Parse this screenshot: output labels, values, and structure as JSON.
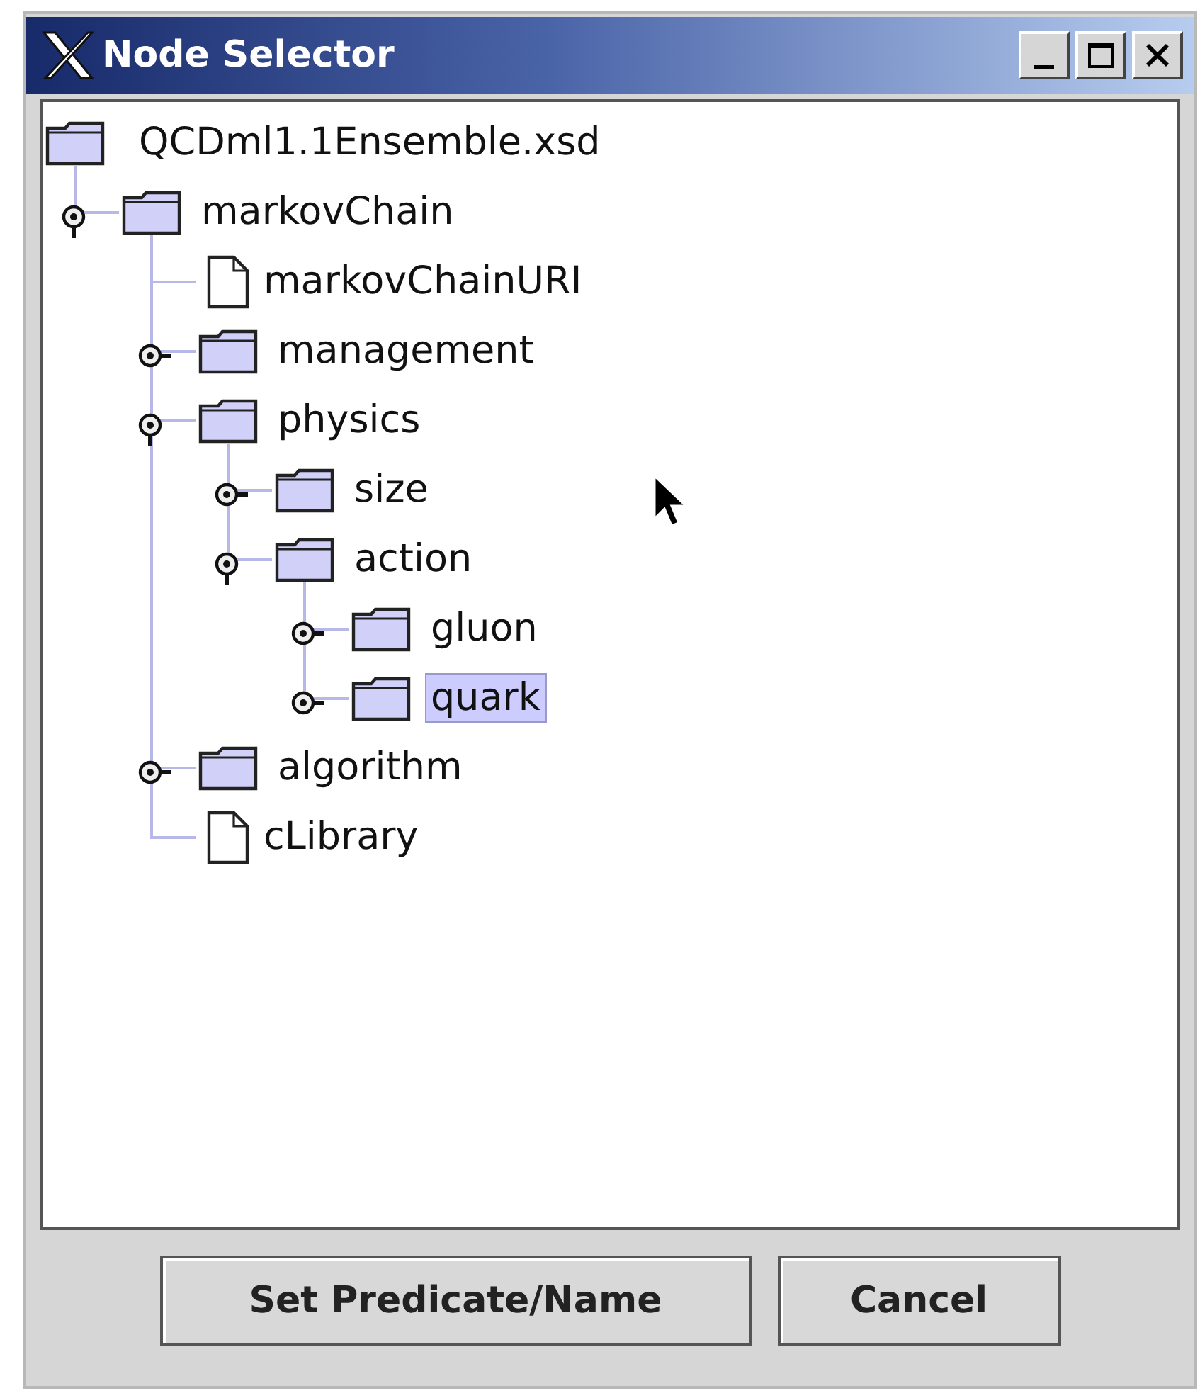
{
  "window": {
    "title": "Node Selector"
  },
  "tree": {
    "label": "QCDml1.1Ensemble.xsd",
    "kind": "folder",
    "selected": false,
    "children": [
      {
        "label": "markovChain",
        "kind": "folder",
        "expanded": true,
        "selected": false,
        "children": [
          {
            "label": "markovChainURI",
            "kind": "file",
            "selected": false
          },
          {
            "label": "management",
            "kind": "folder",
            "expanded": false,
            "selected": false
          },
          {
            "label": "physics",
            "kind": "folder",
            "expanded": true,
            "selected": false,
            "children": [
              {
                "label": "size",
                "kind": "folder",
                "expanded": false,
                "selected": false
              },
              {
                "label": "action",
                "kind": "folder",
                "expanded": true,
                "selected": false,
                "children": [
                  {
                    "label": "gluon",
                    "kind": "folder",
                    "expanded": false,
                    "selected": false
                  },
                  {
                    "label": "quark",
                    "kind": "folder",
                    "expanded": false,
                    "selected": true
                  }
                ]
              }
            ]
          },
          {
            "label": "algorithm",
            "kind": "folder",
            "expanded": false,
            "selected": false
          },
          {
            "label": "cLibrary",
            "kind": "file",
            "selected": false
          }
        ]
      }
    ]
  },
  "buttons": [
    "Set Predicate/Name",
    "Cancel"
  ]
}
